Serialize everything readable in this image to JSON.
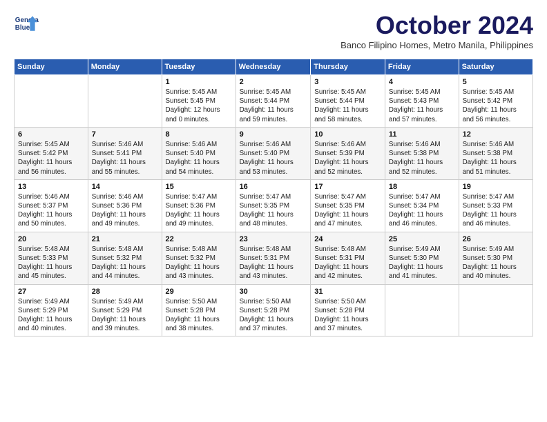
{
  "header": {
    "logo_line1": "General",
    "logo_line2": "Blue",
    "month": "October 2024",
    "subtitle": "Banco Filipino Homes, Metro Manila, Philippines"
  },
  "weekdays": [
    "Sunday",
    "Monday",
    "Tuesday",
    "Wednesday",
    "Thursday",
    "Friday",
    "Saturday"
  ],
  "weeks": [
    [
      {
        "day": "",
        "info": ""
      },
      {
        "day": "",
        "info": ""
      },
      {
        "day": "1",
        "info": "Sunrise: 5:45 AM\nSunset: 5:45 PM\nDaylight: 12 hours\nand 0 minutes."
      },
      {
        "day": "2",
        "info": "Sunrise: 5:45 AM\nSunset: 5:44 PM\nDaylight: 11 hours\nand 59 minutes."
      },
      {
        "day": "3",
        "info": "Sunrise: 5:45 AM\nSunset: 5:44 PM\nDaylight: 11 hours\nand 58 minutes."
      },
      {
        "day": "4",
        "info": "Sunrise: 5:45 AM\nSunset: 5:43 PM\nDaylight: 11 hours\nand 57 minutes."
      },
      {
        "day": "5",
        "info": "Sunrise: 5:45 AM\nSunset: 5:42 PM\nDaylight: 11 hours\nand 56 minutes."
      }
    ],
    [
      {
        "day": "6",
        "info": "Sunrise: 5:45 AM\nSunset: 5:42 PM\nDaylight: 11 hours\nand 56 minutes."
      },
      {
        "day": "7",
        "info": "Sunrise: 5:46 AM\nSunset: 5:41 PM\nDaylight: 11 hours\nand 55 minutes."
      },
      {
        "day": "8",
        "info": "Sunrise: 5:46 AM\nSunset: 5:40 PM\nDaylight: 11 hours\nand 54 minutes."
      },
      {
        "day": "9",
        "info": "Sunrise: 5:46 AM\nSunset: 5:40 PM\nDaylight: 11 hours\nand 53 minutes."
      },
      {
        "day": "10",
        "info": "Sunrise: 5:46 AM\nSunset: 5:39 PM\nDaylight: 11 hours\nand 52 minutes."
      },
      {
        "day": "11",
        "info": "Sunrise: 5:46 AM\nSunset: 5:38 PM\nDaylight: 11 hours\nand 52 minutes."
      },
      {
        "day": "12",
        "info": "Sunrise: 5:46 AM\nSunset: 5:38 PM\nDaylight: 11 hours\nand 51 minutes."
      }
    ],
    [
      {
        "day": "13",
        "info": "Sunrise: 5:46 AM\nSunset: 5:37 PM\nDaylight: 11 hours\nand 50 minutes."
      },
      {
        "day": "14",
        "info": "Sunrise: 5:46 AM\nSunset: 5:36 PM\nDaylight: 11 hours\nand 49 minutes."
      },
      {
        "day": "15",
        "info": "Sunrise: 5:47 AM\nSunset: 5:36 PM\nDaylight: 11 hours\nand 49 minutes."
      },
      {
        "day": "16",
        "info": "Sunrise: 5:47 AM\nSunset: 5:35 PM\nDaylight: 11 hours\nand 48 minutes."
      },
      {
        "day": "17",
        "info": "Sunrise: 5:47 AM\nSunset: 5:35 PM\nDaylight: 11 hours\nand 47 minutes."
      },
      {
        "day": "18",
        "info": "Sunrise: 5:47 AM\nSunset: 5:34 PM\nDaylight: 11 hours\nand 46 minutes."
      },
      {
        "day": "19",
        "info": "Sunrise: 5:47 AM\nSunset: 5:33 PM\nDaylight: 11 hours\nand 46 minutes."
      }
    ],
    [
      {
        "day": "20",
        "info": "Sunrise: 5:48 AM\nSunset: 5:33 PM\nDaylight: 11 hours\nand 45 minutes."
      },
      {
        "day": "21",
        "info": "Sunrise: 5:48 AM\nSunset: 5:32 PM\nDaylight: 11 hours\nand 44 minutes."
      },
      {
        "day": "22",
        "info": "Sunrise: 5:48 AM\nSunset: 5:32 PM\nDaylight: 11 hours\nand 43 minutes."
      },
      {
        "day": "23",
        "info": "Sunrise: 5:48 AM\nSunset: 5:31 PM\nDaylight: 11 hours\nand 43 minutes."
      },
      {
        "day": "24",
        "info": "Sunrise: 5:48 AM\nSunset: 5:31 PM\nDaylight: 11 hours\nand 42 minutes."
      },
      {
        "day": "25",
        "info": "Sunrise: 5:49 AM\nSunset: 5:30 PM\nDaylight: 11 hours\nand 41 minutes."
      },
      {
        "day": "26",
        "info": "Sunrise: 5:49 AM\nSunset: 5:30 PM\nDaylight: 11 hours\nand 40 minutes."
      }
    ],
    [
      {
        "day": "27",
        "info": "Sunrise: 5:49 AM\nSunset: 5:29 PM\nDaylight: 11 hours\nand 40 minutes."
      },
      {
        "day": "28",
        "info": "Sunrise: 5:49 AM\nSunset: 5:29 PM\nDaylight: 11 hours\nand 39 minutes."
      },
      {
        "day": "29",
        "info": "Sunrise: 5:50 AM\nSunset: 5:28 PM\nDaylight: 11 hours\nand 38 minutes."
      },
      {
        "day": "30",
        "info": "Sunrise: 5:50 AM\nSunset: 5:28 PM\nDaylight: 11 hours\nand 37 minutes."
      },
      {
        "day": "31",
        "info": "Sunrise: 5:50 AM\nSunset: 5:28 PM\nDaylight: 11 hours\nand 37 minutes."
      },
      {
        "day": "",
        "info": ""
      },
      {
        "day": "",
        "info": ""
      }
    ]
  ]
}
